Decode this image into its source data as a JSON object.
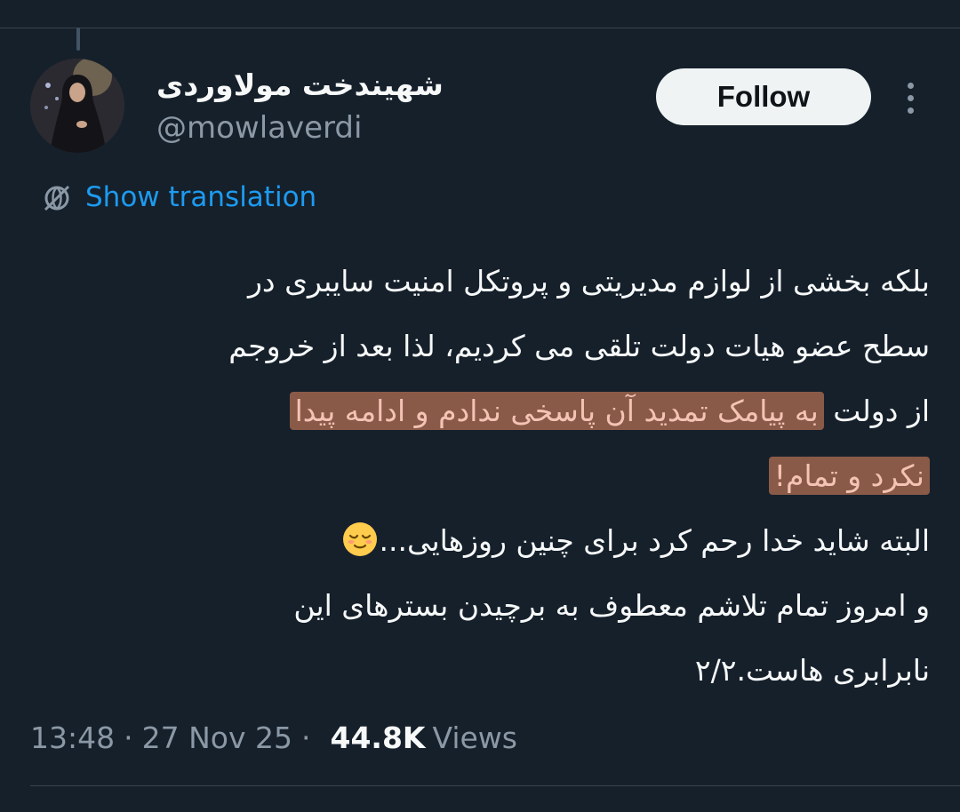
{
  "author": {
    "display_name": "شهیندخت مولاوردی",
    "handle": "@mowlaverdi"
  },
  "follow_button": {
    "label": "Follow"
  },
  "more_menu": {
    "icon": "more-vertical-icon"
  },
  "translation": {
    "icon": "translate-globe-icon",
    "label": "Show translation"
  },
  "tweet": {
    "lines": [
      "بلکه بخشی از لوازم مدیریتی و پروتکل امنیت سایبری در",
      "سطح عضو هیات دولت تلقی می کردیم، لذا بعد از خروجم",
      {
        "plain": "از دولت ",
        "highlight": "به پیامک تمدید آن پاسخی ندادم و ادامه پیدا"
      },
      {
        "plain": "",
        "highlight": "نکرد و تمام!"
      },
      "البته شاید خدا رحم کرد برای چنین روزهایی...",
      "و امروز تمام تلاشم معطوف به برچیدن بسترهای این",
      "نابرابری هاست.۲/۲"
    ],
    "emoji": "relieved-face-icon",
    "highlight_color": "#8a5a48"
  },
  "meta": {
    "time": "13:48",
    "date": "27 Nov 25",
    "views_count": "44.8K",
    "views_label": "Views",
    "separator": "·"
  },
  "colors": {
    "background": "#15202b",
    "text": "#f7f9f9",
    "secondary": "#8b98a5",
    "link": "#1d9bf0",
    "follow_bg": "#eff3f4"
  }
}
